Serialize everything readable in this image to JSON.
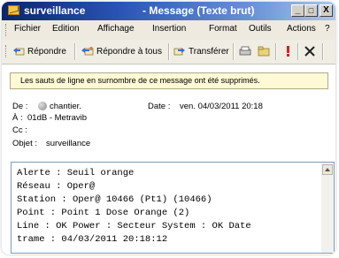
{
  "window": {
    "title_folder": "surveillance",
    "title_suffix": "- Message (Texte brut)",
    "minimize": "_",
    "maximize": "□",
    "close": "X"
  },
  "menu": [
    "Fichier",
    "Edition",
    "Affichage",
    "Insertion",
    "Format",
    "Outils",
    "Actions",
    "?"
  ],
  "toolbar": {
    "reply": "Répondre",
    "reply_all": "Répondre à tous",
    "forward": "Transférer"
  },
  "infobar": "Les sauts de ligne en surnombre de ce message ont été supprimés.",
  "header": {
    "from_label": "De :",
    "from_value": "chantier.",
    "date_label": "Date :",
    "date_value": "ven. 04/03/2011 20:18",
    "to_label": "À :",
    "to_value": "01dB - Metravib",
    "cc_label": "Cc :",
    "subject_label": "Objet :",
    "subject_value": "surveillance"
  },
  "body_lines": [
    "Alerte : Seuil orange",
    "Réseau : Oper@",
    "Station : Oper@ 10466 (Pt1) (10466)",
    "Point : Point 1 Dose Orange (2)",
    "Line : OK Power : Secteur System : OK Date",
    "trame : 04/03/2011 20:18:12"
  ],
  "colors": {
    "titlebar_start": "#0a246a",
    "titlebar_end": "#a6caf0",
    "infobar_bg": "#fff9d6",
    "flag_red": "#d62020"
  },
  "icons": [
    "envelope-icon",
    "reply-icon",
    "reply-all-icon",
    "forward-icon",
    "print-icon",
    "move-folder-icon",
    "importance-icon",
    "delete-icon"
  ]
}
